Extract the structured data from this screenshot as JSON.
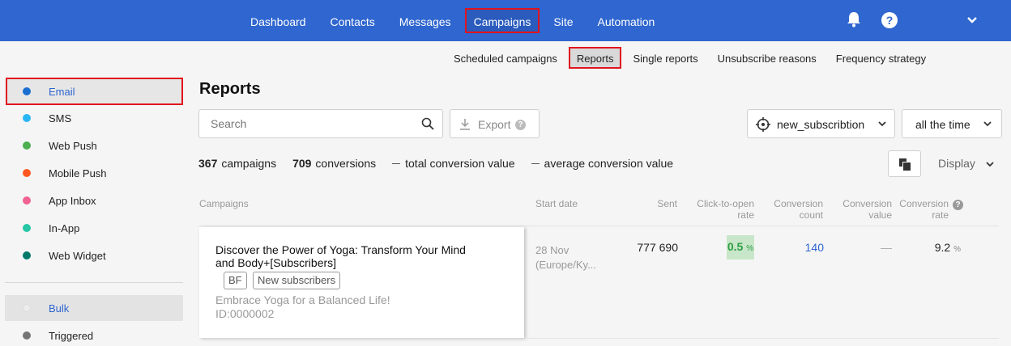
{
  "topnav": {
    "items": [
      "Dashboard",
      "Contacts",
      "Messages",
      "Campaigns",
      "Site",
      "Automation"
    ],
    "active": "Campaigns",
    "help_label": "?"
  },
  "subnav": {
    "items": [
      "Scheduled campaigns",
      "Reports",
      "Single reports",
      "Unsubscribe reasons",
      "Frequency strategy"
    ],
    "active": "Reports"
  },
  "sidebar": {
    "channels": [
      {
        "label": "Email",
        "color": "#1a6fd1"
      },
      {
        "label": "SMS",
        "color": "#29b6f6"
      },
      {
        "label": "Web Push",
        "color": "#4caf50"
      },
      {
        "label": "Mobile Push",
        "color": "#ff5722"
      },
      {
        "label": "App Inbox",
        "color": "#f06292"
      },
      {
        "label": "In-App",
        "color": "#26c6a6"
      },
      {
        "label": "Web Widget",
        "color": "#00796b"
      }
    ],
    "types": [
      {
        "label": "Bulk",
        "color": "#e0e0e0"
      },
      {
        "label": "Triggered",
        "color": "#757575"
      }
    ]
  },
  "page": {
    "title": "Reports",
    "search_placeholder": "Search",
    "export_label": "Export",
    "segment_label": "new_subscribtion",
    "time_label": "all the time",
    "display_label": "Display"
  },
  "stats": {
    "campaigns_count": "367",
    "campaigns_label": "campaigns",
    "conversions_count": "709",
    "conversions_label": "conversions",
    "total_value_label": "total conversion value",
    "avg_value_label": "average conversion value"
  },
  "table": {
    "headers": {
      "campaigns": "Campaigns",
      "start_date": "Start date",
      "sent": "Sent",
      "cto_line1": "Click-to-open",
      "cto_line2": "rate",
      "cc_line1": "Conversion",
      "cc_line2": "count",
      "cv_line1": "Conversion",
      "cv_line2": "value",
      "cr_line1": "Conversion",
      "cr_line2": "rate"
    },
    "rows": [
      {
        "title": "Discover the Power of Yoga: Transform Your Mind and Body+[Subscribers]",
        "tags": [
          "BF",
          "New subscribers"
        ],
        "subject": "Embrace Yoga for a Balanced Life!",
        "id": "ID:0000002",
        "start_line1": "28 Nov",
        "start_line2": "(Europe/Ky...",
        "sent": "777 690",
        "cto_value": "0.5",
        "cto_unit": "%",
        "conversion_count": "140",
        "conversion_value": "—",
        "conversion_rate": "9.2",
        "rate_unit": "%"
      }
    ]
  }
}
